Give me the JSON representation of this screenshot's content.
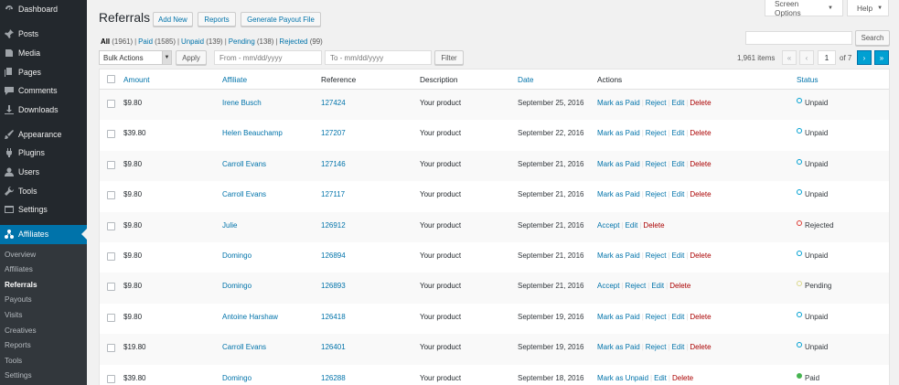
{
  "sidebar": {
    "groups": [
      [
        {
          "label": "Dashboard",
          "icon": "dashboard-icon"
        }
      ],
      [
        {
          "label": "Posts",
          "icon": "pin-icon"
        },
        {
          "label": "Media",
          "icon": "media-icon"
        },
        {
          "label": "Pages",
          "icon": "pages-icon"
        },
        {
          "label": "Comments",
          "icon": "comments-icon"
        },
        {
          "label": "Downloads",
          "icon": "download-icon"
        }
      ],
      [
        {
          "label": "Appearance",
          "icon": "brush-icon"
        },
        {
          "label": "Plugins",
          "icon": "plugin-icon"
        },
        {
          "label": "Users",
          "icon": "users-icon"
        },
        {
          "label": "Tools",
          "icon": "wrench-icon"
        },
        {
          "label": "Settings",
          "icon": "settings-icon"
        }
      ],
      [
        {
          "label": "Affiliates",
          "icon": "affiliates-icon",
          "current": true
        }
      ]
    ],
    "submenu": [
      {
        "label": "Overview"
      },
      {
        "label": "Affiliates"
      },
      {
        "label": "Referrals",
        "current": true
      },
      {
        "label": "Payouts"
      },
      {
        "label": "Visits"
      },
      {
        "label": "Creatives"
      },
      {
        "label": "Reports"
      },
      {
        "label": "Tools"
      },
      {
        "label": "Settings"
      }
    ]
  },
  "top": {
    "screen_options": "Screen Options",
    "help": "Help"
  },
  "header": {
    "title": "Referrals",
    "add_new": "Add New",
    "reports": "Reports",
    "payout": "Generate Payout File"
  },
  "filters": [
    {
      "label": "All",
      "count": "(1961)",
      "current": true
    },
    {
      "label": "Paid",
      "count": "(1585)"
    },
    {
      "label": "Unpaid",
      "count": "(139)"
    },
    {
      "label": "Pending",
      "count": "(138)"
    },
    {
      "label": "Rejected",
      "count": "(99)"
    }
  ],
  "search": {
    "button": "Search",
    "value": ""
  },
  "tablenav": {
    "bulk_actions": "Bulk Actions",
    "apply": "Apply",
    "from_placeholder": "From - mm/dd/yyyy",
    "to_placeholder": "To - mm/dd/yyyy",
    "filter": "Filter",
    "items": "1,961 items",
    "current_page": "1",
    "total_pages": "of 7",
    "first": "«",
    "prev": "‹",
    "next": "›",
    "last": "»"
  },
  "columns": {
    "amount": "Amount",
    "affiliate": "Affiliate",
    "reference": "Reference",
    "description": "Description",
    "date": "Date",
    "actions": "Actions",
    "status": "Status"
  },
  "status_colors": {
    "Unpaid": "#00a0d2",
    "Rejected": "#dd3d36",
    "Pending": "#dbd88c",
    "Paid": "#46b450"
  },
  "rows": [
    {
      "amount": "$9.80",
      "affiliate": "Irene Busch",
      "reference": "127424",
      "description": "Your product",
      "date": "September 25, 2016",
      "actions": [
        "Mark as Paid",
        "Reject",
        "Edit",
        "Delete"
      ],
      "status": "Unpaid"
    },
    {
      "amount": "$39.80",
      "affiliate": "Helen Beauchamp",
      "reference": "127207",
      "description": "Your product",
      "date": "September 22, 2016",
      "actions": [
        "Mark as Paid",
        "Reject",
        "Edit",
        "Delete"
      ],
      "status": "Unpaid"
    },
    {
      "amount": "$9.80",
      "affiliate": "Carroll Evans",
      "reference": "127146",
      "description": "Your product",
      "date": "September 21, 2016",
      "actions": [
        "Mark as Paid",
        "Reject",
        "Edit",
        "Delete"
      ],
      "status": "Unpaid"
    },
    {
      "amount": "$9.80",
      "affiliate": "Carroll Evans",
      "reference": "127117",
      "description": "Your product",
      "date": "September 21, 2016",
      "actions": [
        "Mark as Paid",
        "Reject",
        "Edit",
        "Delete"
      ],
      "status": "Unpaid"
    },
    {
      "amount": "$9.80",
      "affiliate": "Julie",
      "reference": "126912",
      "description": "Your product",
      "date": "September 21, 2016",
      "actions": [
        "Accept",
        "Edit",
        "Delete"
      ],
      "status": "Rejected"
    },
    {
      "amount": "$9.80",
      "affiliate": "Domingo",
      "reference": "126894",
      "description": "Your product",
      "date": "September 21, 2016",
      "actions": [
        "Mark as Paid",
        "Reject",
        "Edit",
        "Delete"
      ],
      "status": "Unpaid"
    },
    {
      "amount": "$9.80",
      "affiliate": "Domingo",
      "reference": "126893",
      "description": "Your product",
      "date": "September 21, 2016",
      "actions": [
        "Accept",
        "Reject",
        "Edit",
        "Delete"
      ],
      "status": "Pending"
    },
    {
      "amount": "$9.80",
      "affiliate": "Antoine Harshaw",
      "reference": "126418",
      "description": "Your product",
      "date": "September 19, 2016",
      "actions": [
        "Mark as Paid",
        "Reject",
        "Edit",
        "Delete"
      ],
      "status": "Unpaid"
    },
    {
      "amount": "$19.80",
      "affiliate": "Carroll Evans",
      "reference": "126401",
      "description": "Your product",
      "date": "September 19, 2016",
      "actions": [
        "Mark as Paid",
        "Reject",
        "Edit",
        "Delete"
      ],
      "status": "Unpaid"
    },
    {
      "amount": "$39.80",
      "affiliate": "Domingo",
      "reference": "126288",
      "description": "Your product",
      "date": "September 18, 2016",
      "actions": [
        "Mark as Unpaid",
        "Edit",
        "Delete"
      ],
      "status": "Paid"
    }
  ]
}
